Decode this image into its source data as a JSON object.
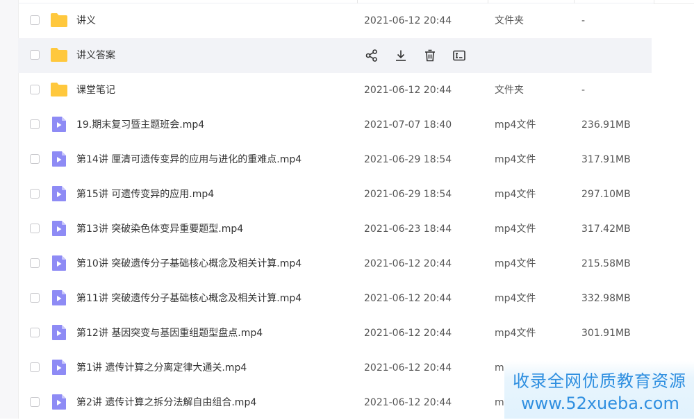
{
  "colors": {
    "folder": "#FFC83D",
    "video": "#8E8BF5",
    "hover_row": "#F2F3F7",
    "watermark_text": "#2F8FE0"
  },
  "hover_actions": [
    "share-icon",
    "download-icon",
    "delete-icon",
    "rename-icon"
  ],
  "files": [
    {
      "name": "讲义",
      "icon": "folder-icon",
      "date": "2021-06-12 20:44",
      "type": "文件夹",
      "size": "-"
    },
    {
      "name": "讲义答案",
      "icon": "folder-icon",
      "date": "",
      "type": "",
      "size": "",
      "hovered": true
    },
    {
      "name": "课堂笔记",
      "icon": "folder-icon",
      "date": "2021-06-12 20:44",
      "type": "文件夹",
      "size": "-"
    },
    {
      "name": "19.期末复习暨主题班会.mp4",
      "icon": "video-file-icon",
      "date": "2021-07-07 18:40",
      "type": "mp4文件",
      "size": "236.91MB"
    },
    {
      "name": "第14讲 厘清可遗传变异的应用与进化的重难点.mp4",
      "icon": "video-file-icon",
      "date": "2021-06-29 18:54",
      "type": "mp4文件",
      "size": "317.91MB"
    },
    {
      "name": "第15讲 可遗传变异的应用.mp4",
      "icon": "video-file-icon",
      "date": "2021-06-29 18:54",
      "type": "mp4文件",
      "size": "297.10MB"
    },
    {
      "name": "第13讲 突破染色体变异重要题型.mp4",
      "icon": "video-file-icon",
      "date": "2021-06-23 18:44",
      "type": "mp4文件",
      "size": "317.42MB"
    },
    {
      "name": "第10讲 突破遗传分子基础核心概念及相关计算.mp4",
      "icon": "video-file-icon",
      "date": "2021-06-12 20:44",
      "type": "mp4文件",
      "size": "215.58MB"
    },
    {
      "name": "第11讲 突破遗传分子基础核心概念及相关计算.mp4",
      "icon": "video-file-icon",
      "date": "2021-06-12 20:44",
      "type": "mp4文件",
      "size": "332.98MB"
    },
    {
      "name": "第12讲 基因突变与基因重组题型盘点.mp4",
      "icon": "video-file-icon",
      "date": "2021-06-12 20:44",
      "type": "mp4文件",
      "size": "301.91MB"
    },
    {
      "name": "第1讲 遗传计算之分离定律大通关.mp4",
      "icon": "video-file-icon",
      "date": "2021-06-12 20:44",
      "type": "m",
      "size": ""
    },
    {
      "name": "第2讲 遗传计算之拆分法解自由组合.mp4",
      "icon": "video-file-icon",
      "date": "2021-06-12 20:44",
      "type": "m",
      "size": ""
    }
  ],
  "watermark": {
    "line1": "收录全网优质教育资源",
    "line2": "www.52xueba.com"
  }
}
